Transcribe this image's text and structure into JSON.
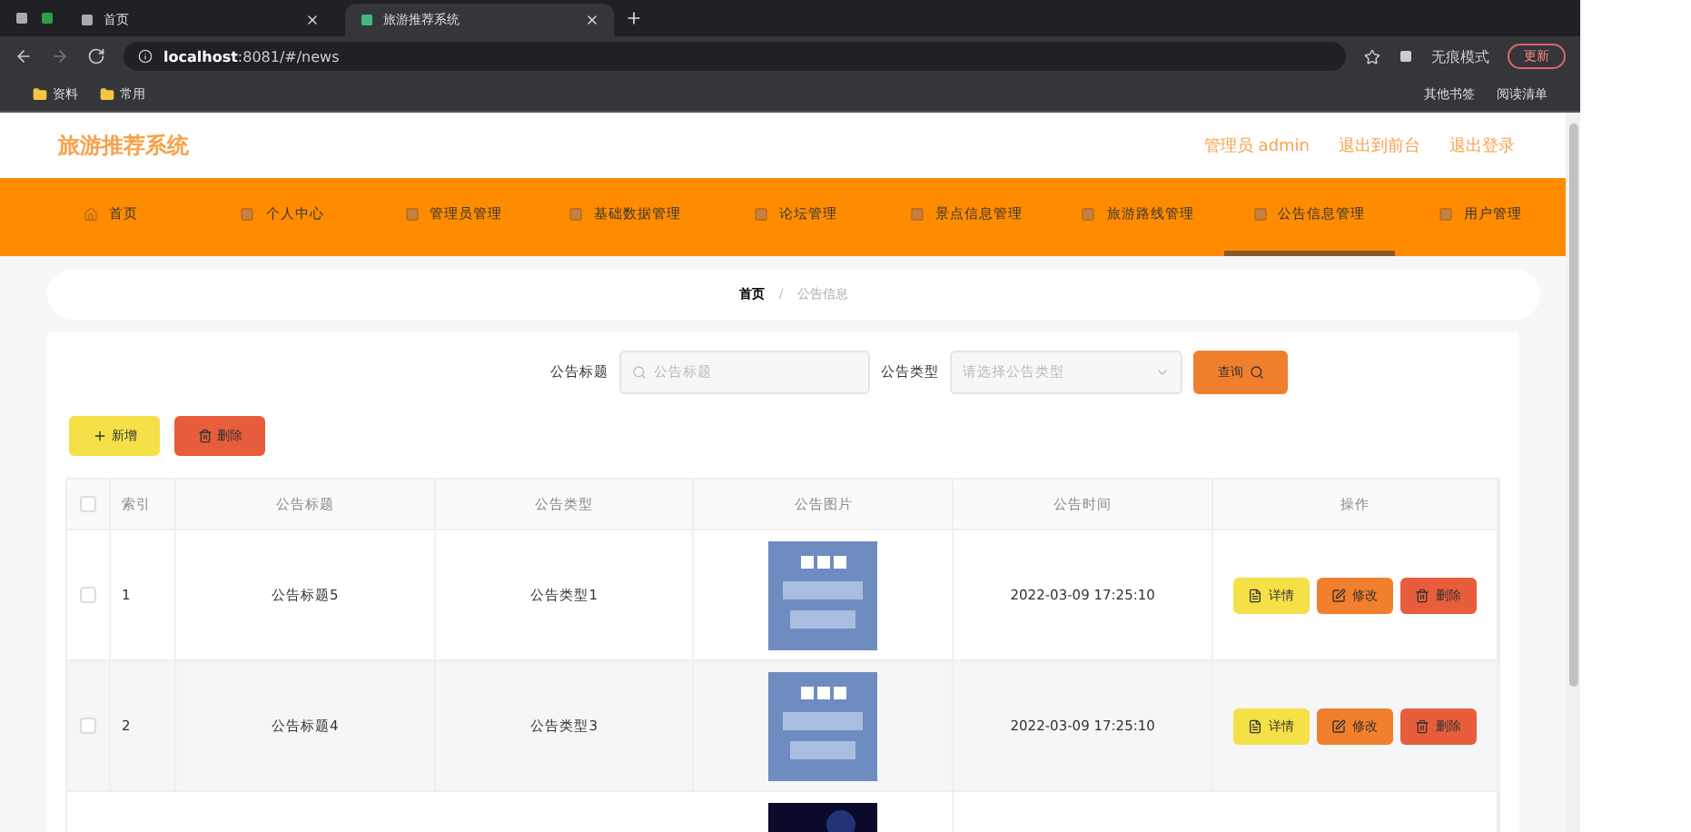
{
  "browser": {
    "tabs": [
      {
        "title": "首页",
        "selected": false
      },
      {
        "title": "旅游推荐系统",
        "selected": true
      }
    ],
    "url_host": "localhost",
    "url_rest": ":8081/#/news",
    "incognito": "无痕模式",
    "update": "更新",
    "bookmarks": [
      "资料",
      "常用"
    ],
    "bookmarks_right": [
      "其他书签",
      "阅读清单"
    ]
  },
  "header": {
    "title": "旅游推荐系统",
    "user": "管理员 admin",
    "links": [
      "退出到前台",
      "退出登录"
    ]
  },
  "nav": [
    {
      "label": "首页",
      "selected": false
    },
    {
      "label": "个人中心",
      "selected": false
    },
    {
      "label": "管理员管理",
      "selected": false
    },
    {
      "label": "基础数据管理",
      "selected": false
    },
    {
      "label": "论坛管理",
      "selected": false
    },
    {
      "label": "景点信息管理",
      "selected": false
    },
    {
      "label": "旅游路线管理",
      "selected": false
    },
    {
      "label": "公告信息管理",
      "selected": true
    },
    {
      "label": "用户管理",
      "selected": false
    }
  ],
  "breadcrumb": [
    "首页",
    "公告信息"
  ],
  "breadcrumb_separator": "/",
  "search": {
    "title_label": "公告标题",
    "title_placeholder": "公告标题",
    "type_label": "公告类型",
    "type_placeholder": "请选择公告类型",
    "button": "查询"
  },
  "actions": {
    "add": "新增",
    "delete": "删除"
  },
  "table": {
    "all_checked": false,
    "columns": [
      "索引",
      "公告标题",
      "公告类型",
      "公告图片",
      "公告时间",
      "操作"
    ],
    "rows": [
      {
        "checked": false,
        "index": "1",
        "title": "公告标题5",
        "type": "公告类型1",
        "image": {
          "kind": "picture"
        },
        "time": "2022-03-09 17:25:10",
        "buttons": [
          "详情",
          "修改",
          "删除"
        ]
      },
      {
        "checked": false,
        "index": "2",
        "title": "公告标题4",
        "type": "公告类型3",
        "image": {
          "kind": "picture"
        },
        "time": "2022-03-09 17:25:10",
        "buttons": [
          "详情",
          "修改",
          "删除"
        ]
      },
      {
        "image": {
          "kind": "picture",
          "dark": true
        }
      }
    ]
  }
}
